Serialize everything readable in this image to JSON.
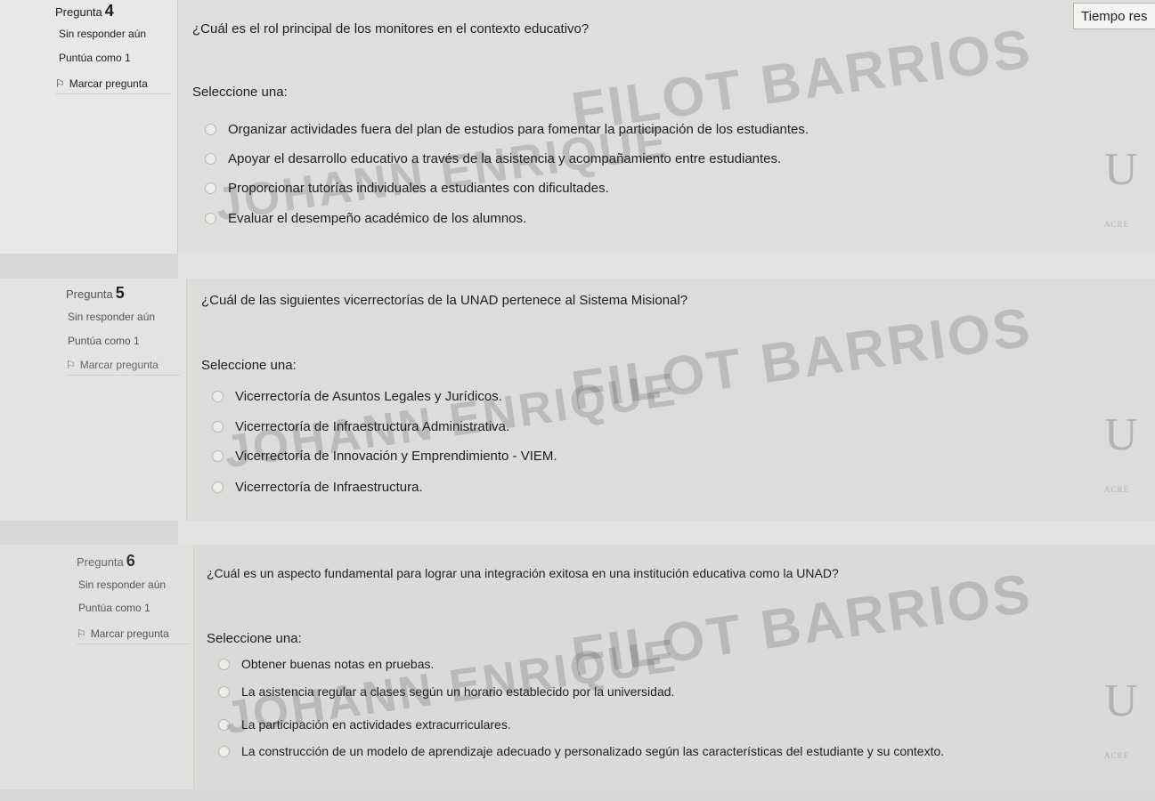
{
  "timer": {
    "label": "Tiempo res"
  },
  "common": {
    "question_prefix": "Pregunta",
    "status": "Sin responder aún",
    "score": "Puntúa como 1",
    "flag_label": "Marcar pregunta",
    "select_one": "Seleccione una:"
  },
  "watermark": {
    "line1": "FILOT BARRIOS",
    "line2": "JOHANN ENRIQUE",
    "logo_letter": "U",
    "logo_text": "ACRE"
  },
  "questions": [
    {
      "number": "4",
      "text": "¿Cuál es el rol principal de los monitores en el contexto educativo?",
      "options": [
        "Organizar actividades fuera del plan de estudios para fomentar la participación de los estudiantes.",
        "Apoyar el desarrollo educativo a través de la asistencia y acompañamiento entre estudiantes.",
        "Proporcionar tutorías individuales a estudiantes con dificultades.",
        "Evaluar el desempeño académico de los alumnos."
      ]
    },
    {
      "number": "5",
      "text": "¿Cuál de las siguientes vicerrectorías de la UNAD pertenece al Sistema Misional?",
      "options": [
        "Vicerrectoría de Asuntos Legales y Jurídicos.",
        "Vicerrectoría de Infraestructura Administrativa.",
        "Vicerrectoría de Innovación y Emprendimiento - VIEM.",
        "Vicerrectoría de Infraestructura."
      ]
    },
    {
      "number": "6",
      "text": "¿Cuál es un aspecto fundamental para lograr una integración exitosa en una institución educativa como la UNAD?",
      "options": [
        "Obtener buenas notas en pruebas.",
        "La asistencia regular a clases según un horario establecido por la universidad.",
        "La participación en actividades extracurriculares.",
        "La construcción de un modelo de aprendizaje adecuado y personalizado según las características del estudiante y su contexto."
      ]
    }
  ]
}
